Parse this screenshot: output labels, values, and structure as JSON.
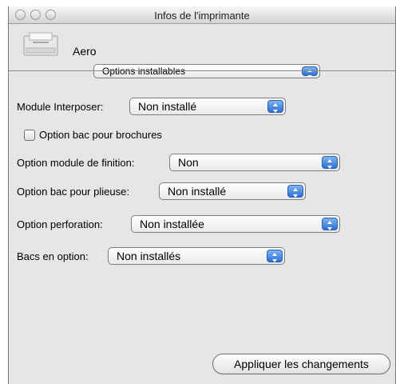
{
  "window": {
    "title": "Infos de l'imprimante"
  },
  "printer": {
    "name": "Aero"
  },
  "section_popup": {
    "value": "Options installables"
  },
  "options": {
    "module_interposer": {
      "label": "Module Interposer:",
      "value": "Non installé"
    },
    "bac_brochures": {
      "label": "Option bac pour brochures",
      "checked": false
    },
    "module_finition": {
      "label": "Option module de finition:",
      "value": "Non"
    },
    "bac_plieuse": {
      "label": "Option bac pour plieuse:",
      "value": "Non installé"
    },
    "perforation": {
      "label": "Option perforation:",
      "value": "Non installée"
    },
    "bacs_option": {
      "label": "Bacs en option:",
      "value": "Non installés"
    }
  },
  "apply_button": {
    "label": "Appliquer les changements"
  },
  "colors": {
    "accent": "#3a7ad8",
    "window_bg": "#e6e6e6"
  }
}
